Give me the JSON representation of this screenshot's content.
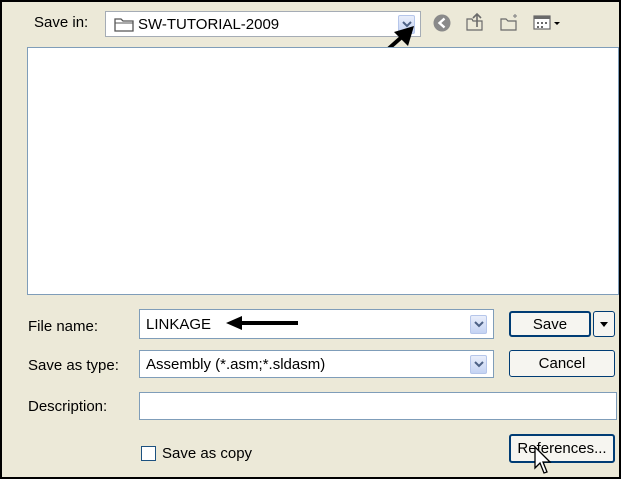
{
  "toolbar": {
    "save_in_label": "Save in:",
    "save_in_value": "SW-TUTORIAL-2009"
  },
  "form": {
    "file_name_label": "File name:",
    "file_name_value": "LINKAGE",
    "save_as_type_label": "Save as type:",
    "save_as_type_value": "Assembly (*.asm;*.sldasm)",
    "description_label": "Description:",
    "description_value": "",
    "save_as_copy_label": "Save as copy",
    "save_as_copy_checked": false
  },
  "buttons": {
    "save": "Save",
    "cancel": "Cancel",
    "references": "References..."
  },
  "icons": {
    "folder": "folder-icon",
    "back": "back-icon",
    "up": "up-folder-icon",
    "new_folder": "new-folder-icon",
    "views": "views-menu-icon",
    "dropdown": "chevron-down-icon"
  }
}
